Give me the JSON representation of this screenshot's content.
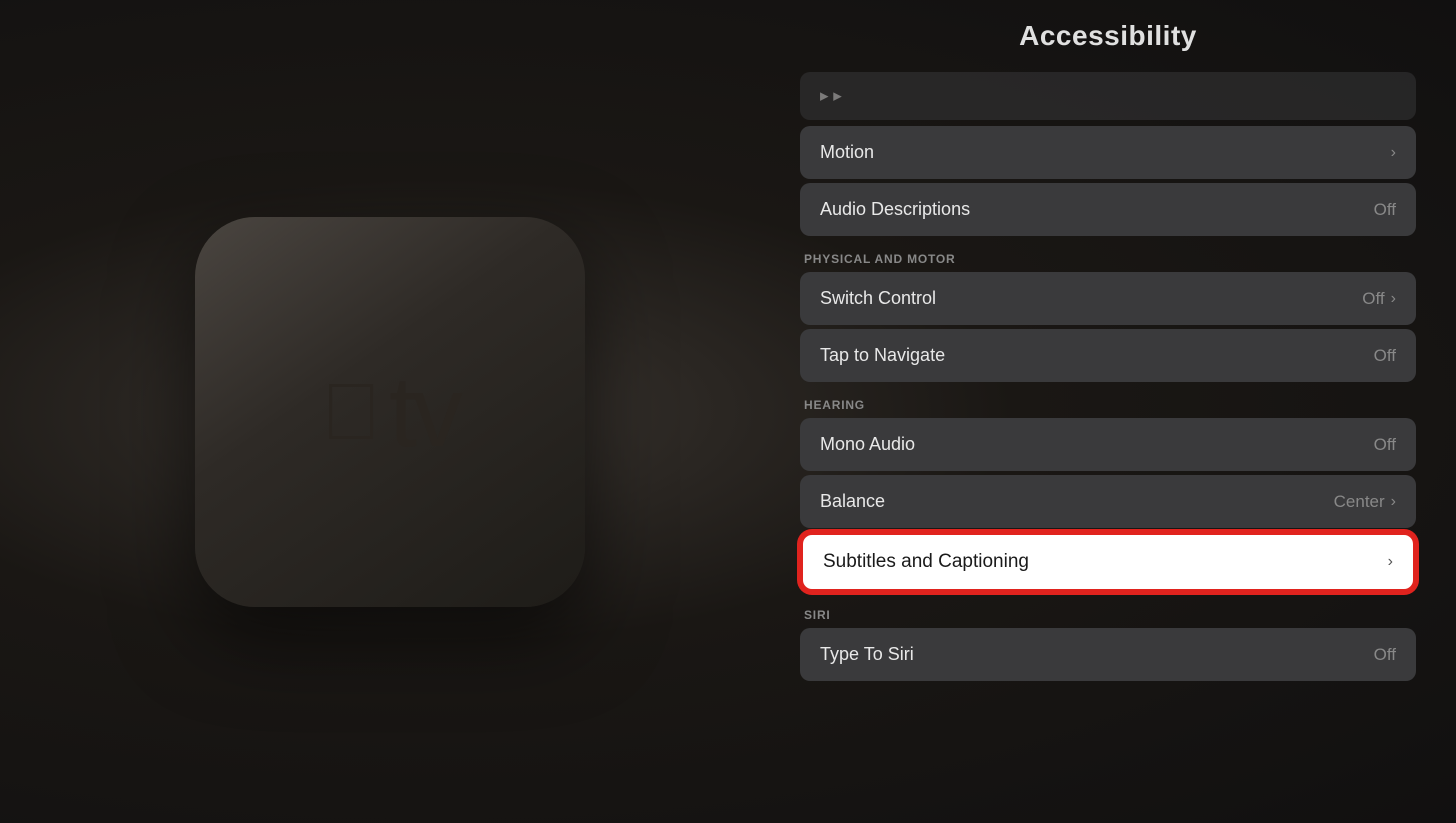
{
  "page": {
    "title": "Accessibility"
  },
  "left": {
    "apple_icon": "",
    "tv_text": "tv"
  },
  "scrolled_above": {
    "label": "..."
  },
  "menu_items": [
    {
      "id": "motion",
      "label": "Motion",
      "value": "",
      "has_chevron": true,
      "section": null
    },
    {
      "id": "audio-descriptions",
      "label": "Audio Descriptions",
      "value": "Off",
      "has_chevron": false,
      "section": null
    },
    {
      "id": "switch-control",
      "label": "Switch Control",
      "value": "Off",
      "has_chevron": true,
      "section": "PHYSICAL AND MOTOR"
    },
    {
      "id": "tap-to-navigate",
      "label": "Tap to Navigate",
      "value": "Off",
      "has_chevron": false,
      "section": null
    },
    {
      "id": "mono-audio",
      "label": "Mono Audio",
      "value": "Off",
      "has_chevron": false,
      "section": "HEARING"
    },
    {
      "id": "balance",
      "label": "Balance",
      "value": "Center",
      "has_chevron": true,
      "section": null
    },
    {
      "id": "subtitles-captioning",
      "label": "Subtitles and Captioning",
      "value": "",
      "has_chevron": true,
      "highlighted": true,
      "section": null
    },
    {
      "id": "type-to-siri",
      "label": "Type To Siri",
      "value": "Off",
      "has_chevron": false,
      "section": "SIRI"
    }
  ],
  "sections": {
    "physical_motor": "PHYSICAL AND MOTOR",
    "hearing": "HEARING",
    "siri": "SIRI"
  }
}
